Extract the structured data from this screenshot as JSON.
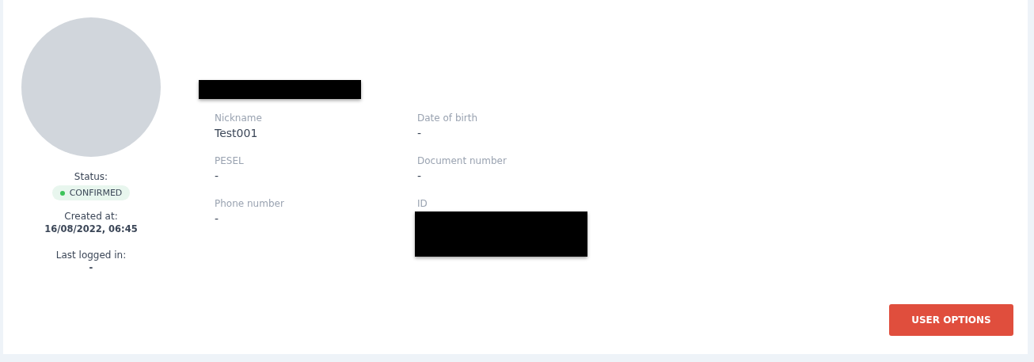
{
  "profile": {
    "name_redacted": true,
    "status_label": "Status:",
    "status": {
      "label": "CONFIRMED",
      "color": "#3cc35a"
    },
    "created_label": "Created at:",
    "created_value": "16/08/2022, 06:45",
    "last_login_label": "Last logged in:",
    "last_login_value": "-"
  },
  "fields": [
    {
      "label": "Nickname",
      "value": "Test001"
    },
    {
      "label": "Date of birth",
      "value": "-"
    },
    {
      "label": "PESEL",
      "value": "-"
    },
    {
      "label": "Document number",
      "value": "-"
    },
    {
      "label": "Phone number",
      "value": "-"
    },
    {
      "label": "ID",
      "redacted": true
    }
  ],
  "buttons": [
    "USER OPTIONS"
  ]
}
